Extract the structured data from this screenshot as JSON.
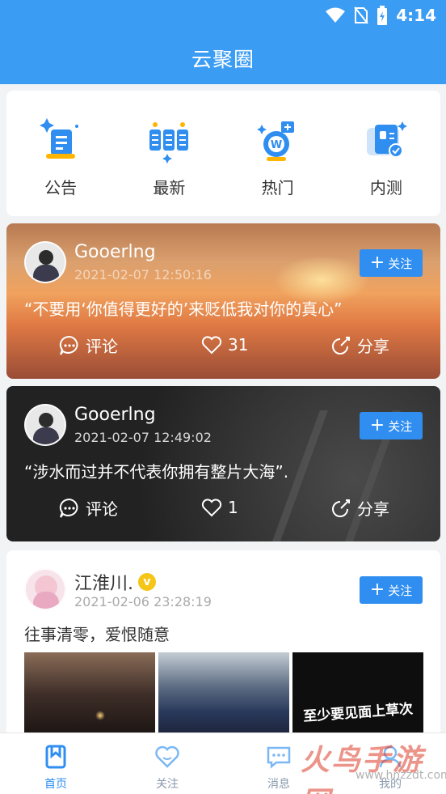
{
  "status_bar": {
    "time": "4:14"
  },
  "header": {
    "title": "云聚圈"
  },
  "categories": [
    {
      "label": "公告",
      "icon": "document-icon"
    },
    {
      "label": "最新",
      "icon": "grid-cards-icon"
    },
    {
      "label": "热门",
      "icon": "hot-medal-icon"
    },
    {
      "label": "内测",
      "icon": "beta-clipboard-icon"
    }
  ],
  "posts": [
    {
      "username": "Gooerlng",
      "time": "2021-02-07 12:50:16",
      "content": "“不要用‘你值得更好的’来贬低我对你的真心”",
      "follow": "关注",
      "comment": "评论",
      "likes": "31",
      "share": "分享"
    },
    {
      "username": "Gooerlng",
      "time": "2021-02-07 12:49:02",
      "content": "“涉水而过并不代表你拥有整片大海”.",
      "follow": "关注",
      "comment": "评论",
      "likes": "1",
      "share": "分享"
    },
    {
      "username": "江淮川.",
      "verified": true,
      "time": "2021-02-06 23:28:19",
      "content": "往事清零，爱恨随意",
      "follow": "关注",
      "image_text": "至少要见面上草次"
    }
  ],
  "tabbar": [
    {
      "label": "首页",
      "icon": "home-icon",
      "active": true
    },
    {
      "label": "关注",
      "icon": "heart-icon",
      "active": false
    },
    {
      "label": "消息",
      "icon": "message-icon",
      "active": false
    },
    {
      "label": "我的",
      "icon": "profile-icon",
      "active": false
    }
  ],
  "watermark": {
    "text": "火鸟手游网",
    "sub": "www.hnzzdt.com"
  },
  "colors": {
    "primary": "#3b9cf4",
    "button": "#2f8ef0",
    "badge": "#f5c518"
  }
}
